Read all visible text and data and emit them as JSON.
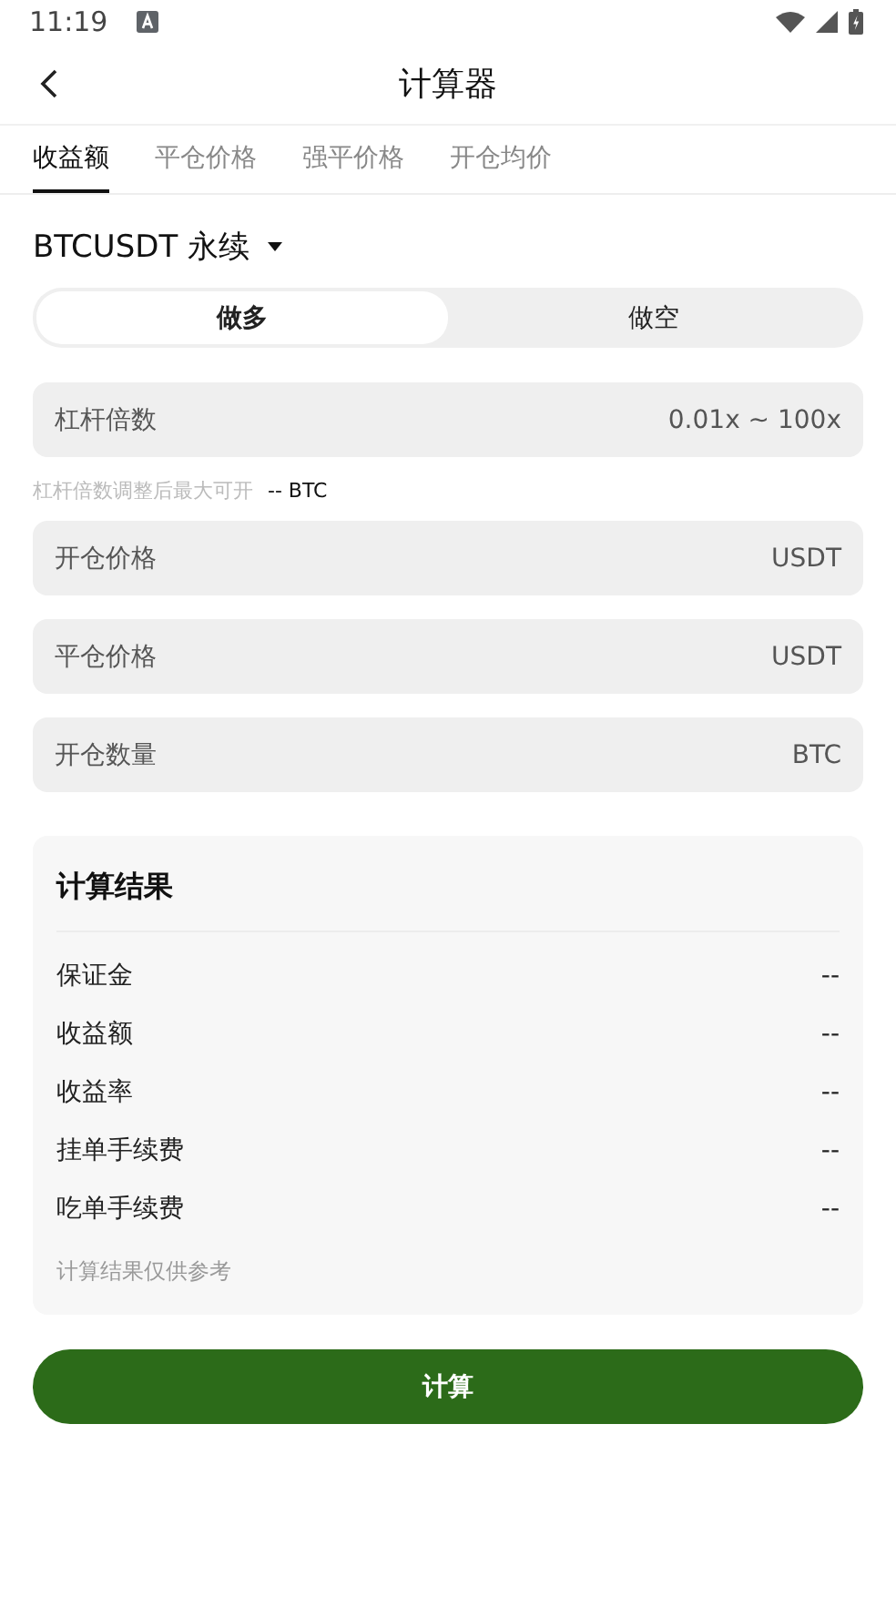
{
  "status_bar": {
    "time": "11:19"
  },
  "header": {
    "title": "计算器"
  },
  "tabs": [
    {
      "label": "收益额",
      "selected": true
    },
    {
      "label": "平仓价格",
      "selected": false
    },
    {
      "label": "强平价格",
      "selected": false
    },
    {
      "label": "开仓均价",
      "selected": false
    }
  ],
  "symbol": {
    "label": "BTCUSDT 永续"
  },
  "direction": [
    {
      "label": "做多",
      "selected": true
    },
    {
      "label": "做空",
      "selected": false
    }
  ],
  "fields": [
    {
      "label": "杠杆倍数",
      "unit": "0.01x ~ 100x"
    },
    {
      "label": "开仓价格",
      "unit": "USDT"
    },
    {
      "label": "平仓价格",
      "unit": "USDT"
    },
    {
      "label": "开仓数量",
      "unit": "BTC"
    }
  ],
  "leverage_hint": {
    "text": "杠杆倍数调整后最大可开",
    "value": "-- BTC"
  },
  "results": {
    "title": "计算结果",
    "rows": [
      {
        "label": "保证金",
        "value": "--"
      },
      {
        "label": "收益额",
        "value": "--"
      },
      {
        "label": "收益率",
        "value": "--"
      },
      {
        "label": "挂单手续费",
        "value": "--"
      },
      {
        "label": "吃单手续费",
        "value": "--"
      }
    ],
    "note": "计算结果仅供参考"
  },
  "submit": {
    "label": "计算"
  }
}
